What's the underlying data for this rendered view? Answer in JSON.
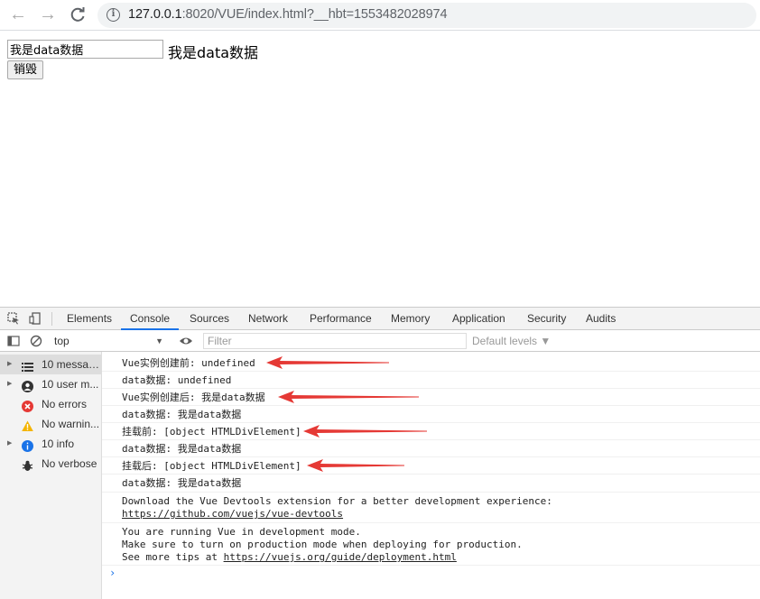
{
  "browser": {
    "url_host": "127.0.0.1",
    "url_path": ":8020/VUE/index.html?__hbt=1553482028974"
  },
  "page": {
    "input_value": "我是data数据",
    "echo_text": "我是data数据",
    "destroy_label": "销毁"
  },
  "devtools": {
    "tabs": [
      "Elements",
      "Console",
      "Sources",
      "Network",
      "Performance",
      "Memory",
      "Application",
      "Security",
      "Audits"
    ],
    "active_tab": "Console",
    "context": "top",
    "filter_placeholder": "Filter",
    "levels_label": "Default levels ▼",
    "sidebar": [
      {
        "label": "10 messag...",
        "icon": "list-icon",
        "expandable": true,
        "selected": true
      },
      {
        "label": "10 user m...",
        "icon": "user-icon",
        "expandable": true,
        "selected": false
      },
      {
        "label": "No errors",
        "icon": "error-icon",
        "expandable": false,
        "selected": false
      },
      {
        "label": "No warnin...",
        "icon": "warning-icon",
        "expandable": false,
        "selected": false
      },
      {
        "label": "10 info",
        "icon": "info-icon",
        "expandable": true,
        "selected": false
      },
      {
        "label": "No verbose",
        "icon": "bug-icon",
        "expandable": false,
        "selected": false
      }
    ],
    "messages": [
      {
        "text": "Vue实例创建前: undefined",
        "arrow": true
      },
      {
        "text": "data数据: undefined",
        "arrow": false
      },
      {
        "text": "Vue实例创建后: 我是data数据",
        "arrow": true
      },
      {
        "text": "data数据: 我是data数据",
        "arrow": false
      },
      {
        "text": "挂载前: [object HTMLDivElement]",
        "arrow": true
      },
      {
        "text": "data数据: 我是data数据",
        "arrow": false
      },
      {
        "text": "挂载后: [object HTMLDivElement]",
        "arrow": true
      },
      {
        "text": "data数据: 我是data数据",
        "arrow": false
      }
    ],
    "devtools_msg_line1": "Download the Vue Devtools extension for a better development experience:",
    "devtools_msg_link": "https://github.com/vuejs/vue-devtools",
    "mode_msg_line1": "You are running Vue in development mode.",
    "mode_msg_line2": "Make sure to turn on production mode when deploying for production.",
    "mode_msg_line3_prefix": "See more tips at ",
    "mode_msg_link": "https://vuejs.org/guide/deployment.html",
    "prompt": "›",
    "arrow_color": "#e53935"
  }
}
